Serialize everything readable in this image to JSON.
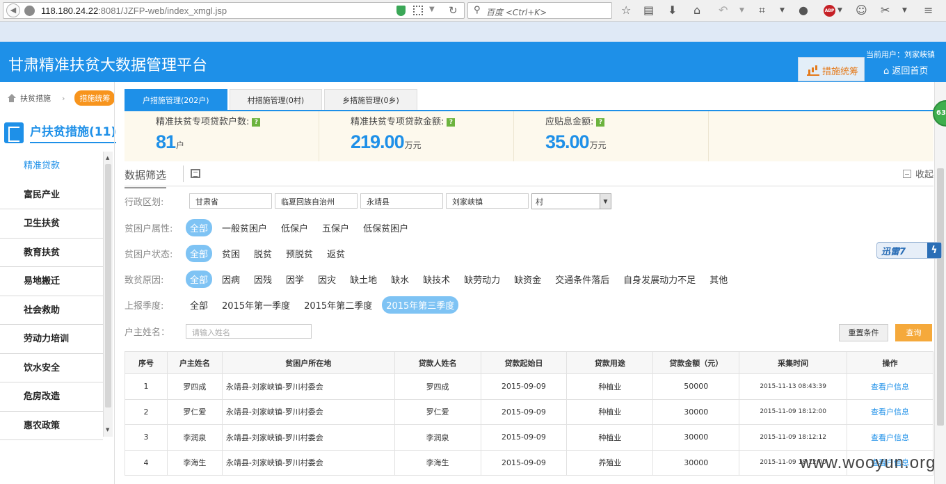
{
  "browser": {
    "url_host": "118.180.24.22",
    "url_rest": ":8081/JZFP-web/index_xmgl.jsp",
    "search_placeholder": "百度 <Ctrl+K>"
  },
  "header": {
    "title": "甘肃精准扶贫大数据管理平台",
    "current_user": "当前用户：刘家峡镇",
    "measures_button": "措施统筹",
    "home_button": "返回首页"
  },
  "breadcrumb": {
    "item1": "扶贫措施",
    "item2": "措施统筹"
  },
  "sidebar": {
    "title": "户扶贫措施(11)",
    "items": [
      "精准贷款",
      "富民产业",
      "卫生扶贫",
      "教育扶贫",
      "易地搬迁",
      "社会救助",
      "劳动力培训",
      "饮水安全",
      "危房改造",
      "惠农政策"
    ]
  },
  "tabs": [
    "户措施管理(202户)",
    "村措施管理(0村)",
    "乡措施管理(0乡)"
  ],
  "stats": [
    {
      "label": "精准扶贫专项贷款户数:",
      "value": "81",
      "unit": "户"
    },
    {
      "label": "精准扶贫专项贷款金额:",
      "value": "219.00",
      "unit": "万元"
    },
    {
      "label": "应贴息金额:",
      "value": "35.00",
      "unit": "万元"
    }
  ],
  "filter": {
    "title": "数据筛选",
    "collapse": "收起",
    "region_label": "行政区划:",
    "region_values": [
      "甘肃省",
      "临夏回族自治州",
      "永靖县",
      "刘家峡镇"
    ],
    "village_select": "村",
    "attr_label": "贫困户属性:",
    "attr_options": [
      "全部",
      "一般贫困户",
      "低保户",
      "五保户",
      "低保贫困户"
    ],
    "status_label": "贫困户状态:",
    "status_options": [
      "全部",
      "贫困",
      "脱贫",
      "预脱贫",
      "返贫"
    ],
    "cause_label": "致贫原因:",
    "cause_options": [
      "全部",
      "因病",
      "因残",
      "因学",
      "因灾",
      "缺土地",
      "缺水",
      "缺技术",
      "缺劳动力",
      "缺资金",
      "交通条件落后",
      "自身发展动力不足",
      "其他"
    ],
    "quarter_label": "上报季度:",
    "quarter_options": [
      "全部",
      "2015年第一季度",
      "2015年第二季度",
      "2015年第三季度"
    ],
    "name_label": "户主姓名：",
    "name_placeholder": "请输入姓名",
    "reset_button": "重置条件",
    "query_button": "查询"
  },
  "table": {
    "headers": [
      "序号",
      "户主姓名",
      "贫困户所在地",
      "贷款人姓名",
      "贷款起始日",
      "贷款用途",
      "贷款金额（元）",
      "采集时间",
      "操作"
    ],
    "rows": [
      [
        "1",
        "罗四成",
        "永靖县-刘家峡镇-罗川村委会",
        "罗四成",
        "2015-09-09",
        "种植业",
        "50000",
        "2015-11-13 08:43:39",
        "查看户信息"
      ],
      [
        "2",
        "罗仁爱",
        "永靖县-刘家峡镇-罗川村委会",
        "罗仁爱",
        "2015-09-09",
        "种植业",
        "30000",
        "2015-11-09 18:12:00",
        "查看户信息"
      ],
      [
        "3",
        "李润泉",
        "永靖县-刘家峡镇-罗川村委会",
        "李润泉",
        "2015-09-09",
        "种植业",
        "30000",
        "2015-11-09 18:12:12",
        "查看户信息"
      ],
      [
        "4",
        "李海生",
        "永靖县-刘家峡镇-罗川村委会",
        "李海生",
        "2015-09-09",
        "养殖业",
        "30000",
        "2015-11-09 18:12:00",
        "查看户信息"
      ]
    ]
  },
  "overlays": {
    "green_badge": "63",
    "xunlei": "迅雷7",
    "watermark": "www.wooyun.org"
  }
}
